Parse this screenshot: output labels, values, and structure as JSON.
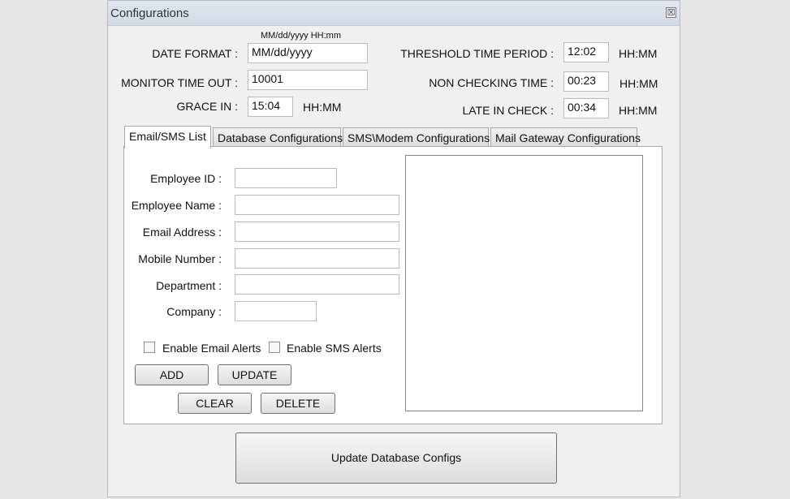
{
  "window": {
    "title": "Configurations",
    "close_glyph": "☒"
  },
  "format_hint": "MM/dd/yyyy HH:mm",
  "date_format": {
    "label": "DATE FORMAT :",
    "value": "MM/dd/yyyy"
  },
  "monitor_timeout": {
    "label": "MONITOR TIME OUT :",
    "value": "10001"
  },
  "grace_in": {
    "label": "GRACE IN :",
    "value": "15:04",
    "unit": "HH:MM"
  },
  "threshold": {
    "label": "THRESHOLD TIME PERIOD :",
    "value": "12:02",
    "unit": "HH:MM"
  },
  "non_checking": {
    "label": "NON CHECKING TIME :",
    "value": "00:23",
    "unit": "HH:MM"
  },
  "late_in_check": {
    "label": "LATE IN CHECK :",
    "value": "00:34",
    "unit": "HH:MM"
  },
  "tabs": [
    "Email/SMS List",
    "Database Configurations",
    "SMS\\Modem Configurations",
    "Mail Gateway Configurations"
  ],
  "form": {
    "employee_id": {
      "label": "Employee ID :",
      "value": ""
    },
    "employee_name": {
      "label": "Employee Name :",
      "value": ""
    },
    "email_address": {
      "label": "Email Address :",
      "value": ""
    },
    "mobile_number": {
      "label": "Mobile Number :",
      "value": ""
    },
    "department": {
      "label": "Department :",
      "value": ""
    },
    "company": {
      "label": "Company :",
      "value": ""
    },
    "enable_email_alerts": {
      "label": "Enable Email Alerts",
      "checked": false
    },
    "enable_sms_alerts": {
      "label": "Enable SMS Alerts",
      "checked": false
    }
  },
  "buttons": {
    "add": "ADD",
    "update": "UPDATE",
    "clear": "CLEAR",
    "delete": "DELETE",
    "update_db": "Update Database Configs"
  }
}
